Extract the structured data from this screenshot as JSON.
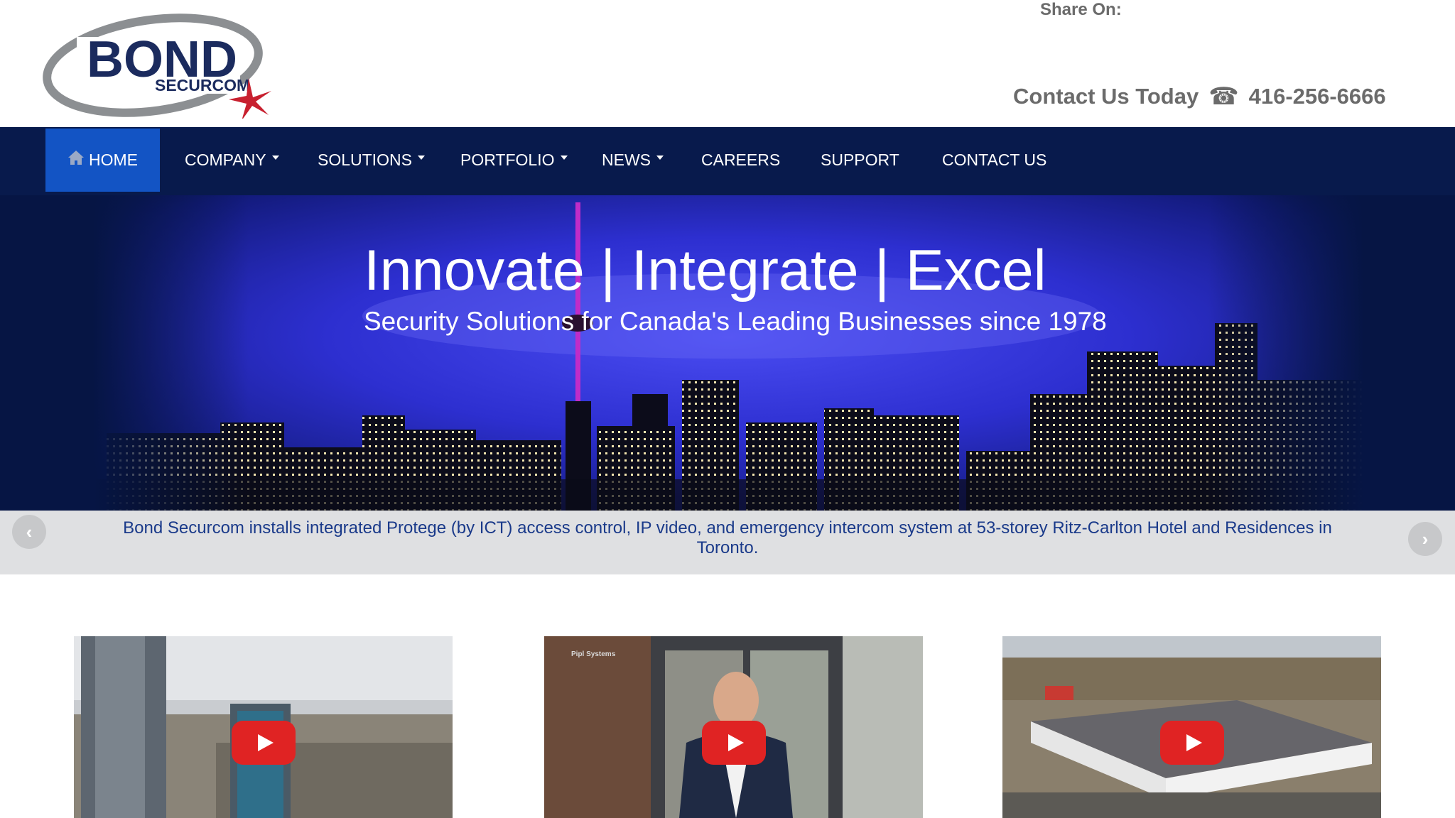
{
  "header": {
    "logo_text": "BOND",
    "logo_subtext": "SECURCOM",
    "share_label": "Share On:",
    "contact_label": "Contact Us Today",
    "phone_icon": "phone-icon",
    "phone_number": "416-256-6666"
  },
  "nav": {
    "items": [
      {
        "label": "HOME",
        "icon": "home-icon",
        "active": true
      },
      {
        "label": "COMPANY",
        "dropdown": true
      },
      {
        "label": "SOLUTIONS",
        "dropdown": true
      },
      {
        "label": "PORTFOLIO",
        "dropdown": true
      },
      {
        "label": "NEWS",
        "dropdown": true
      },
      {
        "label": "CAREERS"
      },
      {
        "label": "SUPPORT"
      },
      {
        "label": "CONTACT US"
      }
    ]
  },
  "hero": {
    "title": "Innovate | Integrate | Excel",
    "subtitle": "Security Solutions for Canada's Leading Businesses since 1978"
  },
  "carousel": {
    "caption": "Bond Securcom installs integrated Protege (by ICT) access control, IP video, and emergency intercom system at 53-storey Ritz-Carlton Hotel and Residences in Toronto.",
    "prev_icon": "chevron-left-icon",
    "next_icon": "chevron-right-icon"
  },
  "videos": {
    "items": [
      {
        "name": "video-thumbnail-towers",
        "icon": "play-icon"
      },
      {
        "name": "video-thumbnail-pipl-systems",
        "overlay_text": "Pipl Systems",
        "icon": "play-icon"
      },
      {
        "name": "video-thumbnail-aerial-building",
        "icon": "play-icon"
      }
    ]
  },
  "colors": {
    "nav_background": "#081a4c",
    "nav_active": "#1354c4",
    "caption_background": "#dfe0e2",
    "caption_text": "#1a3a8a",
    "play_button": "#e02323",
    "logo_navy": "#1b2b5e",
    "logo_red": "#c8202f"
  }
}
